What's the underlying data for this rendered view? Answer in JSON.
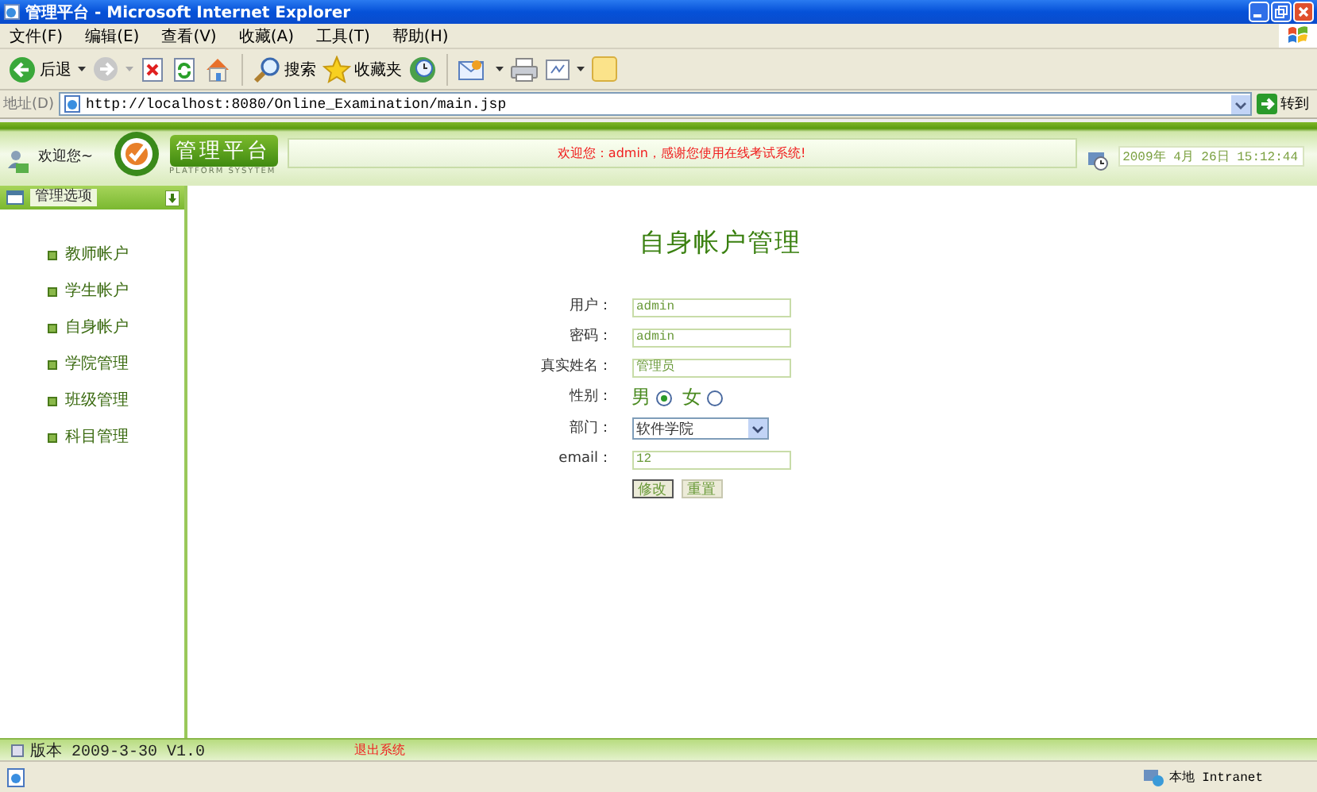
{
  "window": {
    "title": "管理平台 - Microsoft Internet Explorer"
  },
  "menu": [
    "文件(F)",
    "编辑(E)",
    "查看(V)",
    "收藏(A)",
    "工具(T)",
    "帮助(H)"
  ],
  "toolbar": {
    "back": "后退",
    "search": "搜索",
    "favorites": "收藏夹"
  },
  "address": {
    "label": "地址(D)",
    "url": "http://localhost:8080/Online_Examination/main.jsp",
    "go": "转到"
  },
  "header": {
    "greeting": "欢迎您~",
    "logo_title": "管理平台",
    "logo_subtitle": "PLATFORM SYSYTEM",
    "message": "欢迎您：admin，感谢您使用在线考试系统!",
    "datetime": "2009年 4月 26日 15:12:44"
  },
  "sidebar": {
    "title": "管理选项",
    "items": [
      {
        "label": "教师帐户"
      },
      {
        "label": "学生帐户"
      },
      {
        "label": "自身帐户"
      },
      {
        "label": "学院管理"
      },
      {
        "label": "班级管理"
      },
      {
        "label": "科目管理"
      }
    ]
  },
  "form": {
    "title": "自身帐户管理",
    "fields": [
      {
        "kind": "text",
        "label": "用户：",
        "value": "admin"
      },
      {
        "kind": "text",
        "label": "密码：",
        "value": "admin"
      },
      {
        "kind": "text",
        "label": "真实姓名：",
        "value": "管理员"
      },
      {
        "kind": "radio",
        "label": "性别：",
        "options": [
          {
            "label": "男",
            "selected": true
          },
          {
            "label": "女",
            "selected": false
          }
        ]
      },
      {
        "kind": "select",
        "label": "部门：",
        "value": "软件学院"
      },
      {
        "kind": "text",
        "label": "email：",
        "value": "12"
      }
    ],
    "buttons": [
      "修改",
      "重置"
    ]
  },
  "footer": {
    "version": "版本 2009-3-30 V1.0",
    "logout": "退出系统"
  },
  "status_bar": {
    "zone": "本地 Intranet"
  }
}
